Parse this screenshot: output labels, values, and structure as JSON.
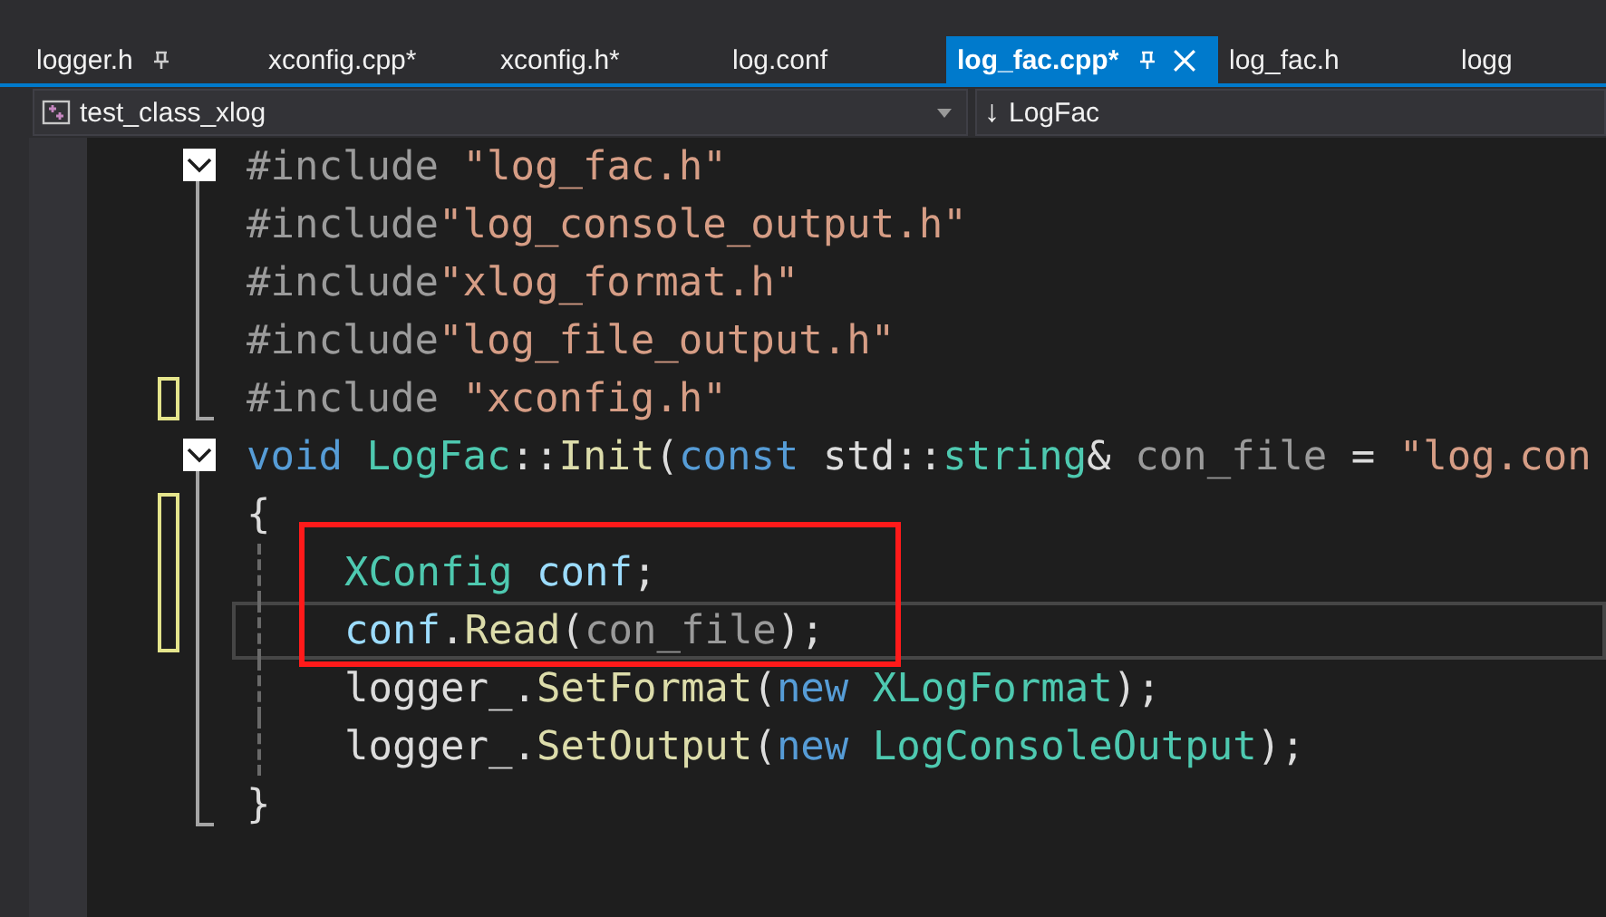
{
  "tabs": [
    {
      "label": "logger.h",
      "selected": false,
      "pinned": true,
      "closable": false
    },
    {
      "label": "xconfig.cpp*",
      "selected": false,
      "pinned": false,
      "closable": false
    },
    {
      "label": "xconfig.h*",
      "selected": false,
      "pinned": false,
      "closable": false
    },
    {
      "label": "log.conf",
      "selected": false,
      "pinned": false,
      "closable": false
    },
    {
      "label": "log_fac.cpp*",
      "selected": true,
      "pinned": true,
      "closable": true
    },
    {
      "label": "log_fac.h",
      "selected": false,
      "pinned": false,
      "closable": false
    },
    {
      "label": "logg",
      "selected": false,
      "pinned": false,
      "closable": false
    }
  ],
  "navigation": {
    "project": "test_class_xlog",
    "scope_arrow": "↓",
    "scope": "LogFac"
  },
  "code_lines": [
    {
      "collapsible": true,
      "changed": false,
      "indent": false,
      "current": false,
      "boxed": false,
      "tokens": [
        {
          "kind": "preprocessor",
          "text": "#include "
        },
        {
          "kind": "string",
          "text": "\"log_fac.h\""
        }
      ]
    },
    {
      "collapsible": false,
      "fold_end": false,
      "changed": false,
      "indent": false,
      "current": false,
      "boxed": false,
      "tokens": [
        {
          "kind": "preprocessor",
          "text": "#include"
        },
        {
          "kind": "string",
          "text": "\"log_console_output.h\""
        }
      ]
    },
    {
      "collapsible": false,
      "fold_end": false,
      "changed": false,
      "indent": false,
      "current": false,
      "boxed": false,
      "tokens": [
        {
          "kind": "preprocessor",
          "text": "#include"
        },
        {
          "kind": "string",
          "text": "\"xlog_format.h\""
        }
      ]
    },
    {
      "collapsible": false,
      "fold_end": false,
      "changed": false,
      "indent": false,
      "current": false,
      "boxed": false,
      "tokens": [
        {
          "kind": "preprocessor",
          "text": "#include"
        },
        {
          "kind": "string",
          "text": "\"log_file_output.h\""
        }
      ]
    },
    {
      "collapsible": false,
      "fold_end": true,
      "changed": true,
      "indent": false,
      "current": false,
      "boxed": false,
      "tokens": [
        {
          "kind": "preprocessor",
          "text": "#include "
        },
        {
          "kind": "string",
          "text": "\"xconfig.h\""
        }
      ]
    },
    {
      "collapsible": true,
      "changed": false,
      "indent": false,
      "current": false,
      "boxed": false,
      "tokens": [
        {
          "kind": "keyword",
          "text": "void "
        },
        {
          "kind": "type",
          "text": "LogFac"
        },
        {
          "kind": "plain",
          "text": "::"
        },
        {
          "kind": "function",
          "text": "Init"
        },
        {
          "kind": "plain",
          "text": "("
        },
        {
          "kind": "keyword",
          "text": "const "
        },
        {
          "kind": "plain",
          "text": "std::"
        },
        {
          "kind": "type",
          "text": "string"
        },
        {
          "kind": "plain",
          "text": "& "
        },
        {
          "kind": "param",
          "text": "con_file"
        },
        {
          "kind": "plain",
          "text": " = "
        },
        {
          "kind": "string",
          "text": "\"log.con"
        }
      ]
    },
    {
      "collapsible": false,
      "fold_end": false,
      "changed": true,
      "indent": false,
      "current": false,
      "boxed": false,
      "tokens": [
        {
          "kind": "plain",
          "text": "{"
        }
      ]
    },
    {
      "collapsible": false,
      "fold_end": false,
      "changed": true,
      "indent": true,
      "current": false,
      "boxed": true,
      "tokens": [
        {
          "kind": "type",
          "text": "XConfig "
        },
        {
          "kind": "variable",
          "text": "conf"
        },
        {
          "kind": "plain",
          "text": ";"
        }
      ]
    },
    {
      "collapsible": false,
      "fold_end": false,
      "changed": true,
      "indent": true,
      "current": true,
      "boxed": true,
      "tokens": [
        {
          "kind": "variable",
          "text": "conf"
        },
        {
          "kind": "plain",
          "text": "."
        },
        {
          "kind": "function",
          "text": "Read"
        },
        {
          "kind": "plain",
          "text": "("
        },
        {
          "kind": "param",
          "text": "con_file"
        },
        {
          "kind": "plain",
          "text": ");"
        }
      ]
    },
    {
      "collapsible": false,
      "fold_end": false,
      "changed": false,
      "indent": true,
      "current": false,
      "boxed": false,
      "tokens": [
        {
          "kind": "plain",
          "text": "logger_."
        },
        {
          "kind": "function",
          "text": "SetFormat"
        },
        {
          "kind": "plain",
          "text": "("
        },
        {
          "kind": "keyword",
          "text": "new "
        },
        {
          "kind": "type",
          "text": "XLogFormat"
        },
        {
          "kind": "plain",
          "text": ");"
        }
      ]
    },
    {
      "collapsible": false,
      "fold_end": false,
      "changed": false,
      "indent": true,
      "current": false,
      "boxed": false,
      "tokens": [
        {
          "kind": "plain",
          "text": "logger_."
        },
        {
          "kind": "function",
          "text": "SetOutput"
        },
        {
          "kind": "plain",
          "text": "("
        },
        {
          "kind": "keyword",
          "text": "new "
        },
        {
          "kind": "type",
          "text": "LogConsoleOutput"
        },
        {
          "kind": "plain",
          "text": ");"
        }
      ]
    },
    {
      "collapsible": false,
      "fold_end": true,
      "changed": false,
      "indent": false,
      "current": false,
      "boxed": false,
      "tokens": [
        {
          "kind": "plain",
          "text": "}"
        }
      ]
    }
  ]
}
